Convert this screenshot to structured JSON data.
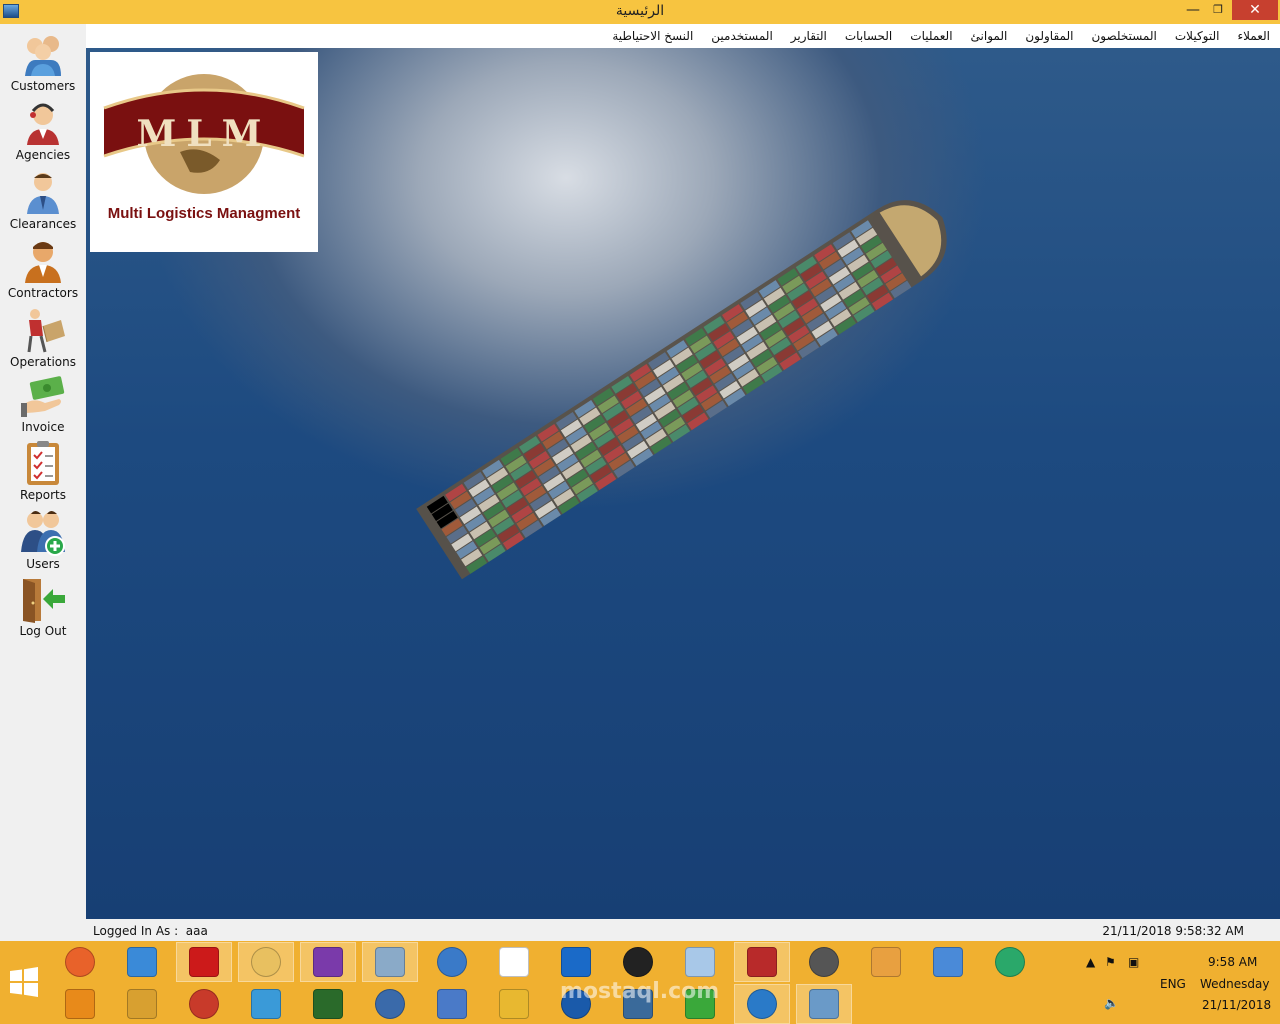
{
  "window": {
    "title": "الرئيسية"
  },
  "menu": [
    "العملاء",
    "التوكيلات",
    "المستخلصون",
    "المقاولون",
    "الموانئ",
    "العمليات",
    "الحسابات",
    "التقارير",
    "المستخدمين",
    "النسخ الاحتياطية"
  ],
  "sidebar": [
    {
      "label": "Customers",
      "icon": "customers-icon"
    },
    {
      "label": "Agencies",
      "icon": "agent-headset-icon"
    },
    {
      "label": "Clearances",
      "icon": "clearance-person-icon"
    },
    {
      "label": "Contractors",
      "icon": "contractor-person-icon"
    },
    {
      "label": "Operations",
      "icon": "delivery-box-icon"
    },
    {
      "label": "Invoice",
      "icon": "money-hand-icon"
    },
    {
      "label": "Reports",
      "icon": "clipboard-icon"
    },
    {
      "label": "Users",
      "icon": "add-users-icon"
    },
    {
      "label": "Log Out",
      "icon": "exit-door-icon"
    }
  ],
  "logo": {
    "initials": "MLM",
    "brand": "Multi Logistics Managment"
  },
  "status": {
    "logged_in_label": "Logged In As :",
    "user": "aaa",
    "datetime": "21/11/2018 9:58:32 AM"
  },
  "taskbar": {
    "watermark": "mostaql.com",
    "apps": [
      "firefox-icon",
      "chrome-icon",
      "opera-icon",
      "file-explorer-icon",
      "visual-studio-icon",
      "monitor-icon",
      "network-icon",
      "blank-file-icon",
      "defender-icon",
      "cmd-icon",
      "notepad-icon",
      "access-icon",
      "database-icon",
      "paint-icon",
      "colorful-icon",
      "atom-icon",
      "sublime-icon",
      "tools-icon",
      "toolbox-icon",
      "media-icon",
      "globe-icon",
      "python-icon",
      "python2-icon",
      "powershell-icon",
      "js-icon",
      "postgres-icon",
      "add-app-icon",
      "remote-icon",
      "ship-app-icon"
    ]
  },
  "tray": {
    "lang": "ENG",
    "time": "9:58 AM",
    "day": "Wednesday",
    "date": "21/11/2018"
  }
}
